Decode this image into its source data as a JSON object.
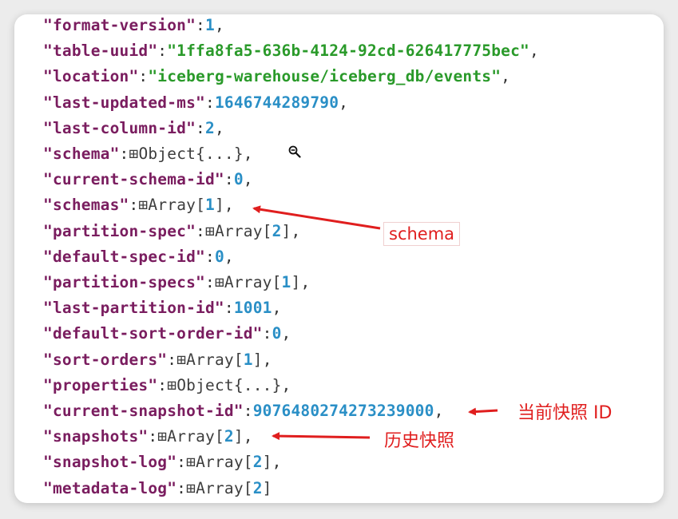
{
  "lines": [
    {
      "key": "\"format-version\"",
      "sep": ":",
      "value": "1",
      "vtype": "n",
      "punct": ","
    },
    {
      "key": "\"table-uuid\"",
      "sep": ":",
      "value": "\"1ffa8fa5-636b-4124-92cd-626417775bec\"",
      "vtype": "s",
      "punct": ","
    },
    {
      "key": "\"location\"",
      "sep": ":",
      "value": "\"iceberg-warehouse/iceberg_db/events\"",
      "vtype": "s",
      "punct": ","
    },
    {
      "key": "\"last-updated-ms\"",
      "sep": ":",
      "value": "1646744289790",
      "vtype": "n",
      "punct": ","
    },
    {
      "key": "\"last-column-id\"",
      "sep": ":",
      "value": "2",
      "vtype": "n",
      "punct": ","
    },
    {
      "key": "\"schema\"",
      "sep": ":",
      "toggle": "⊞",
      "prefix": "Object{...}",
      "punct": ","
    },
    {
      "key": "\"current-schema-id\"",
      "sep": ":",
      "value": "0",
      "vtype": "n",
      "punct": ","
    },
    {
      "key": "\"schemas\"",
      "sep": ":",
      "toggle": "⊞",
      "prefix": "Array[",
      "value": "1",
      "suffix": "]",
      "punct": ","
    },
    {
      "key": "\"partition-spec\"",
      "sep": ":",
      "toggle": "⊞",
      "prefix": "Array[",
      "value": "2",
      "suffix": "]",
      "punct": ","
    },
    {
      "key": "\"default-spec-id\"",
      "sep": ":",
      "value": "0",
      "vtype": "n",
      "punct": ","
    },
    {
      "key": "\"partition-specs\"",
      "sep": ":",
      "toggle": "⊞",
      "prefix": "Array[",
      "value": "1",
      "suffix": "]",
      "punct": ","
    },
    {
      "key": "\"last-partition-id\"",
      "sep": ":",
      "value": "1001",
      "vtype": "n",
      "punct": ","
    },
    {
      "key": "\"default-sort-order-id\"",
      "sep": ":",
      "value": "0",
      "vtype": "n",
      "punct": ","
    },
    {
      "key": "\"sort-orders\"",
      "sep": ":",
      "toggle": "⊞",
      "prefix": "Array[",
      "value": "1",
      "suffix": "]",
      "punct": ","
    },
    {
      "key": "\"properties\"",
      "sep": ":",
      "toggle": "⊞",
      "prefix": "Object{...}",
      "punct": ","
    },
    {
      "key": "\"current-snapshot-id\"",
      "sep": ":",
      "value": "9076480274273239000",
      "vtype": "n",
      "punct": ","
    },
    {
      "key": "\"snapshots\"",
      "sep": ":",
      "toggle": "⊞",
      "prefix": "Array[",
      "value": "2",
      "suffix": "]",
      "punct": ","
    },
    {
      "key": "\"snapshot-log\"",
      "sep": ":",
      "toggle": "⊞",
      "prefix": "Array[",
      "value": "2",
      "suffix": "]",
      "punct": ","
    },
    {
      "key": "\"metadata-log\"",
      "sep": ":",
      "toggle": "⊞",
      "prefix": "Array[",
      "value": "2",
      "suffix": "]",
      "punct": ""
    }
  ],
  "annotations": {
    "schema": "schema",
    "current_snapshot": "当前快照 ID",
    "snapshots": "历史快照"
  },
  "icons": {
    "zoom": "zoom-out-icon",
    "toggle": "expand-toggle-icon"
  },
  "colors": {
    "key": "#7a1d5f",
    "string": "#2a9a2a",
    "number": "#2a8fc6",
    "annotation": "#e01e1e"
  }
}
